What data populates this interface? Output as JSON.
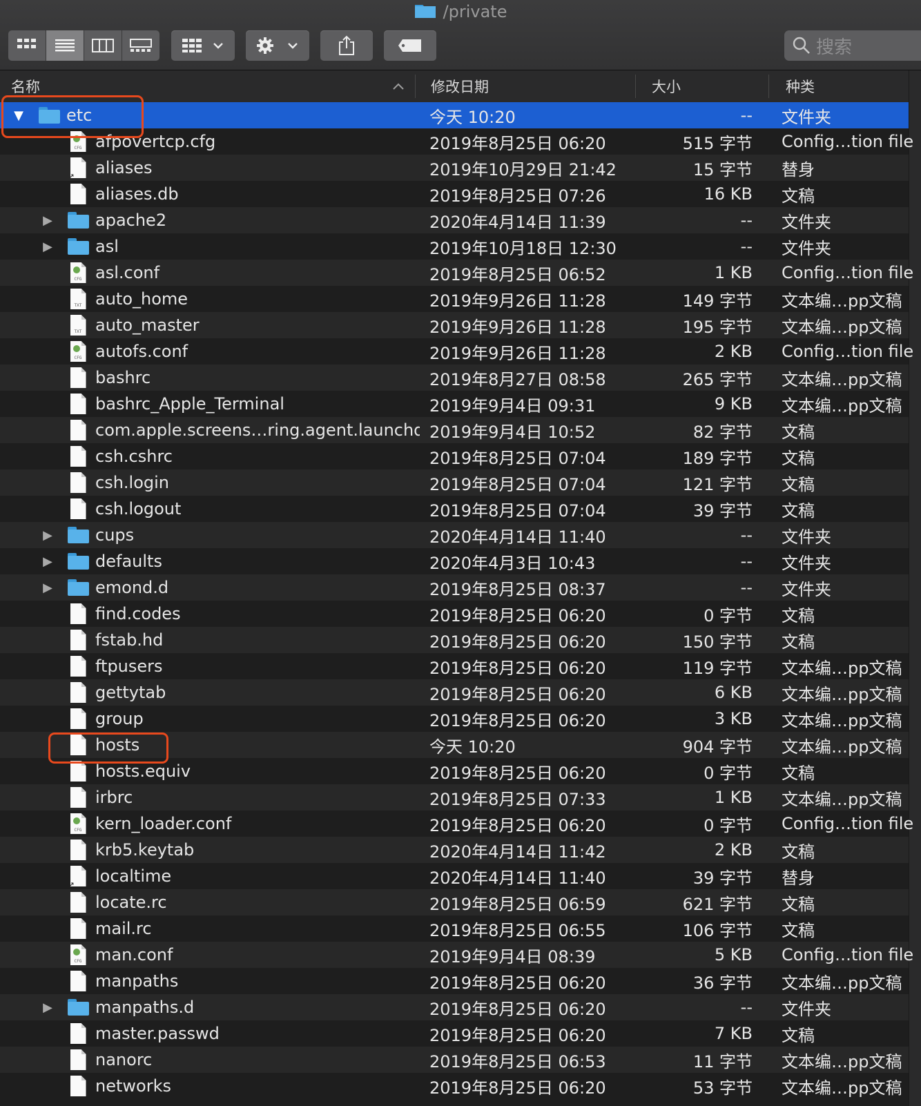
{
  "window": {
    "title": "/private"
  },
  "toolbar": {
    "search_placeholder": "搜索"
  },
  "columns": {
    "name": "名称",
    "date": "修改日期",
    "size": "大小",
    "kind": "种类"
  },
  "selected_folder": {
    "name": "etc",
    "date": "今天 10:20",
    "size": "--",
    "kind": "文件夹"
  },
  "files": [
    {
      "name": "afpovertcp.cfg",
      "date": "2019年8月25日 06:20",
      "size": "515 字节",
      "kind": "Config…tion file",
      "icon": "cfg-icon"
    },
    {
      "name": "aliases",
      "date": "2019年10月29日 21:42",
      "size": "15 字节",
      "kind": "替身",
      "icon": "alias-icon"
    },
    {
      "name": "aliases.db",
      "date": "2019年8月25日 07:26",
      "size": "16 KB",
      "kind": "文稿",
      "icon": "document-icon"
    },
    {
      "name": "apache2",
      "date": "2020年4月14日 11:39",
      "size": "--",
      "kind": "文件夹",
      "icon": "folder-icon"
    },
    {
      "name": "asl",
      "date": "2019年10月18日 12:30",
      "size": "--",
      "kind": "文件夹",
      "icon": "folder-icon"
    },
    {
      "name": "asl.conf",
      "date": "2019年8月25日 06:52",
      "size": "1 KB",
      "kind": "Config…tion file",
      "icon": "cfg-icon"
    },
    {
      "name": "auto_home",
      "date": "2019年9月26日 11:28",
      "size": "149 字节",
      "kind": "文本编…pp文稿",
      "icon": "txt-icon"
    },
    {
      "name": "auto_master",
      "date": "2019年9月26日 11:28",
      "size": "195 字节",
      "kind": "文本编…pp文稿",
      "icon": "txt-icon"
    },
    {
      "name": "autofs.conf",
      "date": "2019年9月26日 11:28",
      "size": "2 KB",
      "kind": "Config…tion file",
      "icon": "cfg-icon"
    },
    {
      "name": "bashrc",
      "date": "2019年8月27日 08:58",
      "size": "265 字节",
      "kind": "文本编…pp文稿",
      "icon": "document-icon"
    },
    {
      "name": "bashrc_Apple_Terminal",
      "date": "2019年9月4日 09:31",
      "size": "9 KB",
      "kind": "文本编…pp文稿",
      "icon": "document-icon"
    },
    {
      "name": "com.apple.screens…ring.agent.launchd",
      "date": "2019年9月4日 10:52",
      "size": "82 字节",
      "kind": "文稿",
      "icon": "document-icon"
    },
    {
      "name": "csh.cshrc",
      "date": "2019年8月25日 07:04",
      "size": "189 字节",
      "kind": "文稿",
      "icon": "document-icon"
    },
    {
      "name": "csh.login",
      "date": "2019年8月25日 07:04",
      "size": "121 字节",
      "kind": "文稿",
      "icon": "document-icon"
    },
    {
      "name": "csh.logout",
      "date": "2019年8月25日 07:04",
      "size": "39 字节",
      "kind": "文稿",
      "icon": "document-icon"
    },
    {
      "name": "cups",
      "date": "2020年4月14日 11:40",
      "size": "--",
      "kind": "文件夹",
      "icon": "folder-icon"
    },
    {
      "name": "defaults",
      "date": "2020年4月3日 10:43",
      "size": "--",
      "kind": "文件夹",
      "icon": "folder-icon"
    },
    {
      "name": "emond.d",
      "date": "2019年8月25日 08:37",
      "size": "--",
      "kind": "文件夹",
      "icon": "folder-icon"
    },
    {
      "name": "find.codes",
      "date": "2019年8月25日 06:20",
      "size": "0 字节",
      "kind": "文稿",
      "icon": "document-icon"
    },
    {
      "name": "fstab.hd",
      "date": "2019年8月25日 06:20",
      "size": "150 字节",
      "kind": "文稿",
      "icon": "document-icon"
    },
    {
      "name": "ftpusers",
      "date": "2019年8月25日 06:20",
      "size": "119 字节",
      "kind": "文本编…pp文稿",
      "icon": "document-icon"
    },
    {
      "name": "gettytab",
      "date": "2019年8月25日 06:20",
      "size": "6 KB",
      "kind": "文本编…pp文稿",
      "icon": "document-icon"
    },
    {
      "name": "group",
      "date": "2019年8月25日 06:20",
      "size": "3 KB",
      "kind": "文本编…pp文稿",
      "icon": "document-icon"
    },
    {
      "name": "hosts",
      "date": "今天 10:20",
      "size": "904 字节",
      "kind": "文本编…pp文稿",
      "icon": "document-icon"
    },
    {
      "name": "hosts.equiv",
      "date": "2019年8月25日 06:20",
      "size": "0 字节",
      "kind": "文稿",
      "icon": "document-icon"
    },
    {
      "name": "irbrc",
      "date": "2019年8月25日 07:33",
      "size": "1 KB",
      "kind": "文本编…pp文稿",
      "icon": "document-icon"
    },
    {
      "name": "kern_loader.conf",
      "date": "2019年8月25日 06:20",
      "size": "0 字节",
      "kind": "Config…tion file",
      "icon": "cfg-icon"
    },
    {
      "name": "krb5.keytab",
      "date": "2020年4月14日 11:42",
      "size": "2 KB",
      "kind": "文稿",
      "icon": "document-icon"
    },
    {
      "name": "localtime",
      "date": "2020年4月14日 11:40",
      "size": "39 字节",
      "kind": "替身",
      "icon": "alias-icon"
    },
    {
      "name": "locate.rc",
      "date": "2019年8月25日 06:59",
      "size": "621 字节",
      "kind": "文稿",
      "icon": "document-icon"
    },
    {
      "name": "mail.rc",
      "date": "2019年8月25日 06:55",
      "size": "106 字节",
      "kind": "文稿",
      "icon": "document-icon"
    },
    {
      "name": "man.conf",
      "date": "2019年9月4日 08:39",
      "size": "5 KB",
      "kind": "Config…tion file",
      "icon": "cfg-icon"
    },
    {
      "name": "manpaths",
      "date": "2019年8月25日 06:20",
      "size": "36 字节",
      "kind": "文本编…pp文稿",
      "icon": "document-icon"
    },
    {
      "name": "manpaths.d",
      "date": "2019年8月25日 06:20",
      "size": "--",
      "kind": "文件夹",
      "icon": "folder-icon"
    },
    {
      "name": "master.passwd",
      "date": "2019年8月25日 06:20",
      "size": "7 KB",
      "kind": "文稿",
      "icon": "document-icon"
    },
    {
      "name": "nanorc",
      "date": "2019年8月25日 06:53",
      "size": "11 字节",
      "kind": "文本编…pp文稿",
      "icon": "document-icon"
    },
    {
      "name": "networks",
      "date": "2019年8月25日 06:20",
      "size": "53 字节",
      "kind": "文本编…pp文稿",
      "icon": "document-icon"
    }
  ],
  "annotations": {
    "color": "#e8491d",
    "highlighted": [
      "etc",
      "hosts"
    ]
  }
}
